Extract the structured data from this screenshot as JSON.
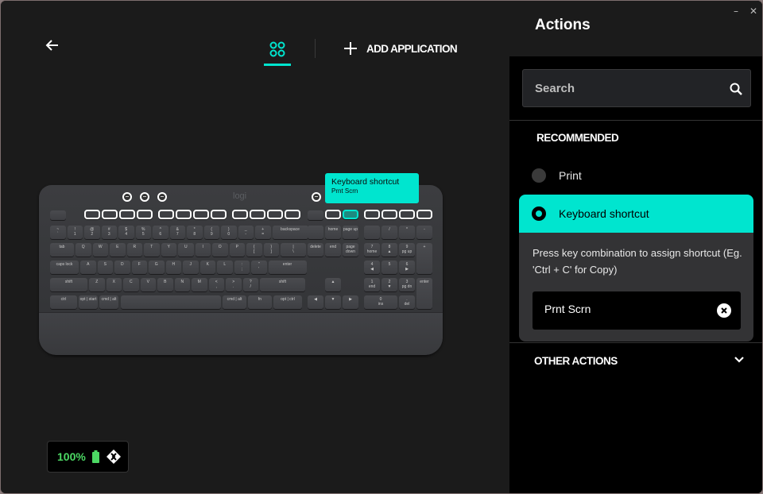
{
  "header": {
    "back_icon": "arrow-left-icon",
    "apps_icon": "apps-grid-icon",
    "add_application_label": "ADD APPLICATION"
  },
  "keyboard": {
    "logo": "logi",
    "highlighted_key": "print-screen",
    "tooltip": {
      "title": "Keyboard shortcut",
      "subtitle": "Prnt Scrn"
    },
    "rows": {
      "number": [
        "~\n`",
        "!\n1",
        "@\n2",
        "#\n3",
        "$\n4",
        "%\n5",
        "^\n6",
        "&\n7",
        "*\n8",
        "(\n9",
        ")\n0",
        "_\n-",
        "+\n=",
        "backspace"
      ],
      "qwerty": [
        "tab",
        "Q",
        "W",
        "E",
        "R",
        "T",
        "Y",
        "U",
        "I",
        "O",
        "P",
        "{\n[",
        "}\n]",
        "|\n\\"
      ],
      "home": [
        "caps lock",
        "A",
        "S",
        "D",
        "F",
        "G",
        "H",
        "J",
        "K",
        "L",
        ":\n;",
        "\"\n'",
        "enter"
      ],
      "shift": [
        "shift",
        "Z",
        "X",
        "C",
        "V",
        "B",
        "N",
        "M",
        "<\n,",
        ">\n.",
        "?\n/",
        "shift"
      ],
      "bottom": [
        "ctrl",
        "opt | start",
        "cmd | alt",
        "",
        "cmd | alt",
        "fn",
        "opt | ctrl"
      ],
      "nav_top": [
        "",
        "home",
        "page up"
      ],
      "nav_mid": [
        "delete",
        "end",
        "page down"
      ],
      "numpad": [
        "",
        "/",
        "*",
        "-",
        "7\nhome",
        "8\n▲",
        "9\npg up",
        "+",
        "4\n◀",
        "5",
        "6\n▶",
        "1\nend",
        "2\n▼",
        "3\npg dn",
        "enter",
        "0\nins",
        ".\ndel"
      ]
    }
  },
  "battery": {
    "percent": "100%",
    "level": 1.0,
    "color": "#4cd964"
  },
  "panel": {
    "title": "Actions",
    "minimize": "–",
    "close": "✕",
    "search_placeholder": "Search",
    "recommended_title": "RECOMMENDED",
    "options": [
      {
        "label": "Print",
        "selected": false
      },
      {
        "label": "Keyboard shortcut",
        "selected": true
      }
    ],
    "hint": "Press key combination to assign shortcut (Eg. 'Ctrl + C' for Copy)",
    "shortcut_value": "Prnt Scrn",
    "other_actions_title": "OTHER ACTIONS",
    "accent_color": "#00e5cf"
  }
}
